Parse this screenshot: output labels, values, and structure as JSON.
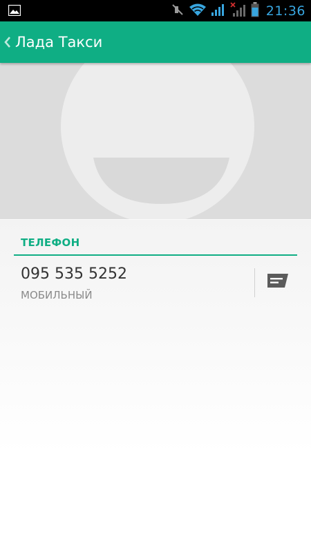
{
  "status_bar": {
    "time": "21:36",
    "icons": [
      "gallery-notification-icon",
      "mute-icon",
      "wifi-icon",
      "signal-icon",
      "no-signal-icon",
      "battery-icon"
    ],
    "time_color": "#38a6e0"
  },
  "action_bar": {
    "title": "Лада Такси",
    "back_icon": "chevron-left-icon",
    "background_color": "#0fae84"
  },
  "contact_photo": {
    "icon": "default-contact-avatar"
  },
  "phone_section": {
    "header": "ТЕЛЕФОН",
    "accent_color": "#0fae84",
    "entries": [
      {
        "number": "095 535 5252",
        "type": "МОБИЛЬНЫЙ",
        "action_icon": "message-icon"
      }
    ]
  }
}
